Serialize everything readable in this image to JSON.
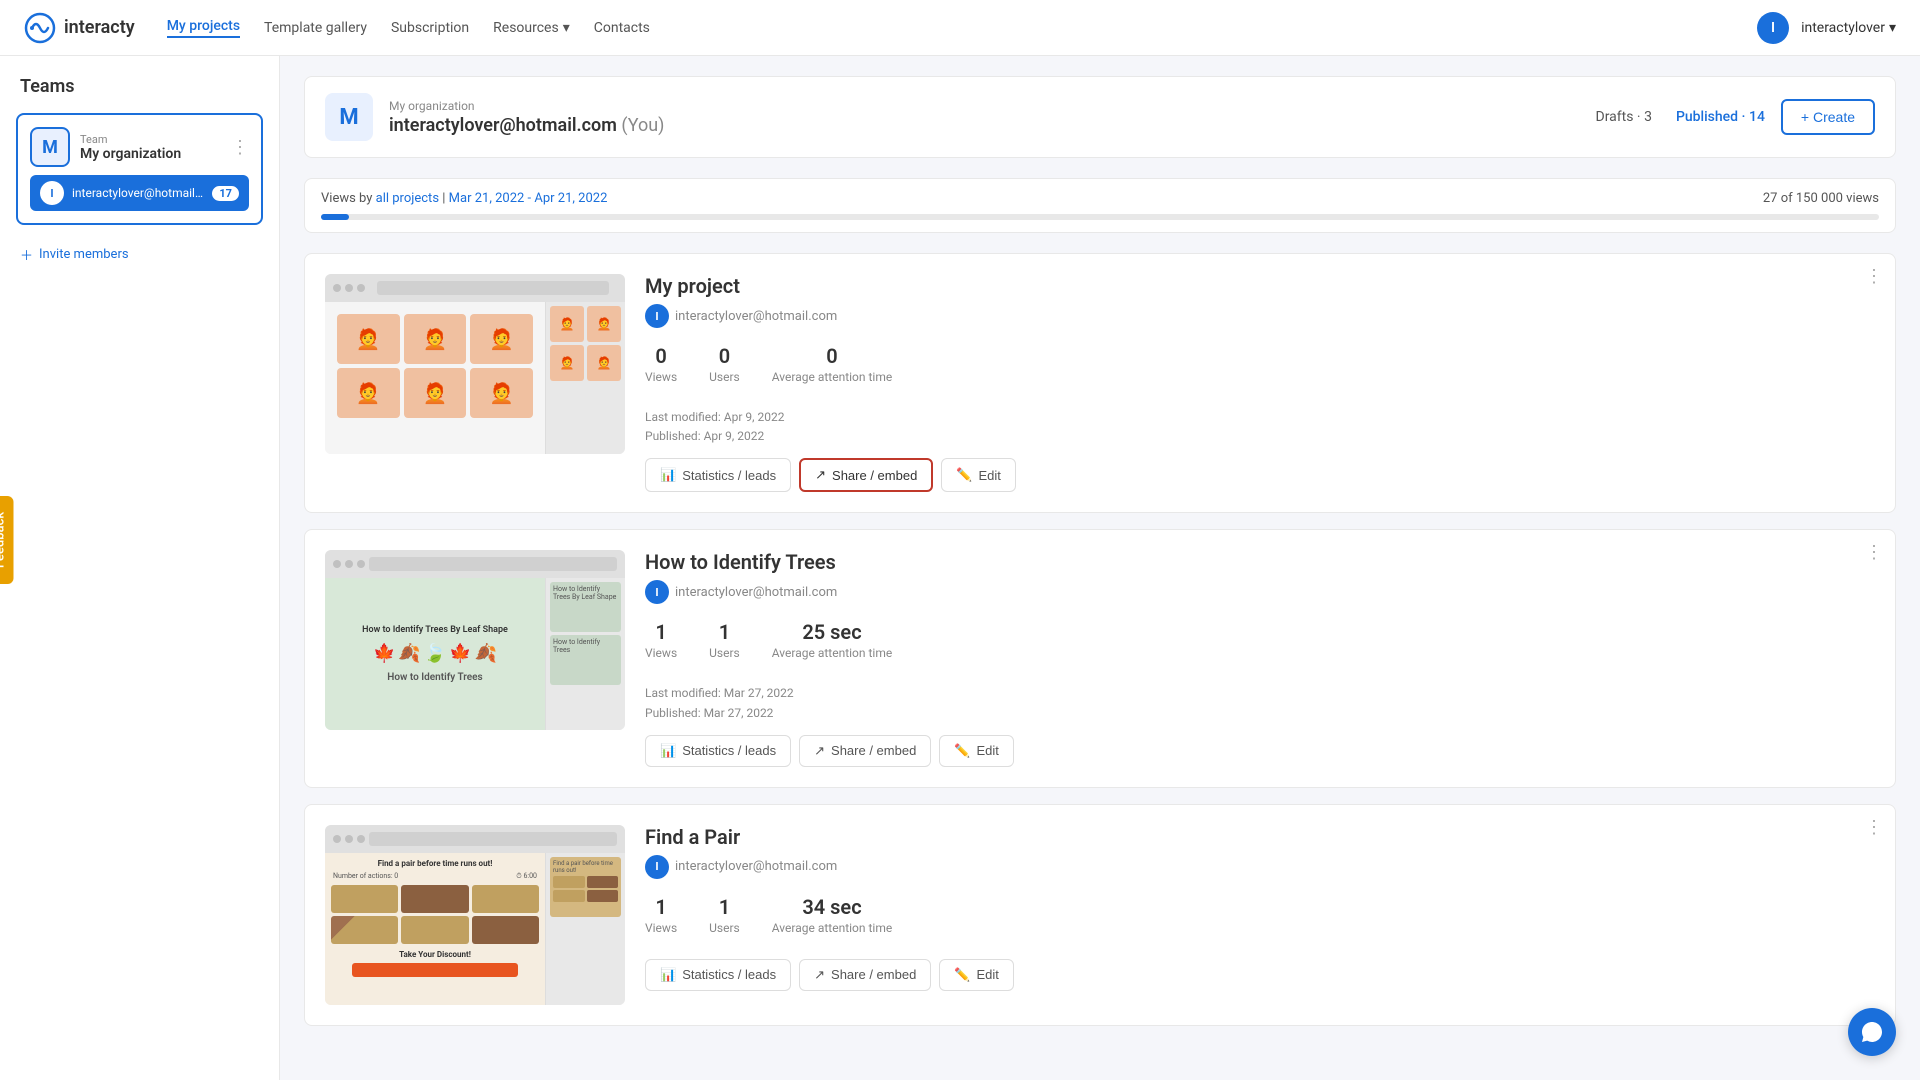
{
  "navbar": {
    "logo_text": "interacty",
    "links": [
      {
        "label": "My projects",
        "active": true
      },
      {
        "label": "Template gallery",
        "active": false
      },
      {
        "label": "Subscription",
        "active": false
      },
      {
        "label": "Resources",
        "active": false,
        "has_dropdown": true
      },
      {
        "label": "Contacts",
        "active": false
      }
    ],
    "user_name": "interactylover",
    "user_initial": "I"
  },
  "sidebar": {
    "title": "Teams",
    "team": {
      "label": "Team",
      "name": "My organization",
      "initial": "M"
    },
    "member": {
      "initial": "I",
      "email": "interactylover@hotmail.co...",
      "count": "17"
    },
    "invite_label": "Invite members"
  },
  "feedback": {
    "label": "Feedback"
  },
  "org_header": {
    "initial": "M",
    "label": "My organization",
    "email": "interactylover@hotmail.com",
    "you_label": "(You)",
    "drafts_label": "Drafts",
    "drafts_count": "3",
    "published_label": "Published",
    "published_count": "14",
    "create_label": "+ Create"
  },
  "views": {
    "label": "Views by",
    "label_highlight": "all projects",
    "date_range": "Mar 21, 2022 - Apr 21, 2022",
    "current": 27,
    "total": 150000,
    "display_total": "150 000",
    "bar_percent": 0.018
  },
  "projects": [
    {
      "name": "My project",
      "author_email": "interactylover@hotmail.com",
      "author_initial": "I",
      "views": "0",
      "users": "0",
      "avg_attention": "0",
      "views_label": "Views",
      "users_label": "Users",
      "avg_label": "Average attention time",
      "last_modified": "Last modified: Apr 9, 2022",
      "published": "Published: Apr 9, 2022",
      "stats_btn": "Statistics / leads",
      "share_btn": "Share / embed",
      "edit_btn": "Edit",
      "share_highlighted": true,
      "type": "faces"
    },
    {
      "name": "How to Identify Trees",
      "author_email": "interactylover@hotmail.com",
      "author_initial": "I",
      "views": "1",
      "users": "1",
      "avg_attention": "25 sec",
      "views_label": "Views",
      "users_label": "Users",
      "avg_label": "Average attention time",
      "last_modified": "Last modified: Mar 27, 2022",
      "published": "Published: Mar 27, 2022",
      "stats_btn": "Statistics / leads",
      "share_btn": "Share / embed",
      "edit_btn": "Edit",
      "share_highlighted": false,
      "type": "trees"
    },
    {
      "name": "Find a Pair",
      "author_email": "interactylover@hotmail.com",
      "author_initial": "I",
      "views": "1",
      "users": "1",
      "avg_attention": "34 sec",
      "views_label": "Views",
      "users_label": "Users",
      "avg_label": "Average attention time",
      "last_modified": "",
      "published": "",
      "stats_btn": "Statistics / leads",
      "share_btn": "Share / embed",
      "edit_btn": "Edit",
      "share_highlighted": false,
      "type": "pair"
    }
  ]
}
